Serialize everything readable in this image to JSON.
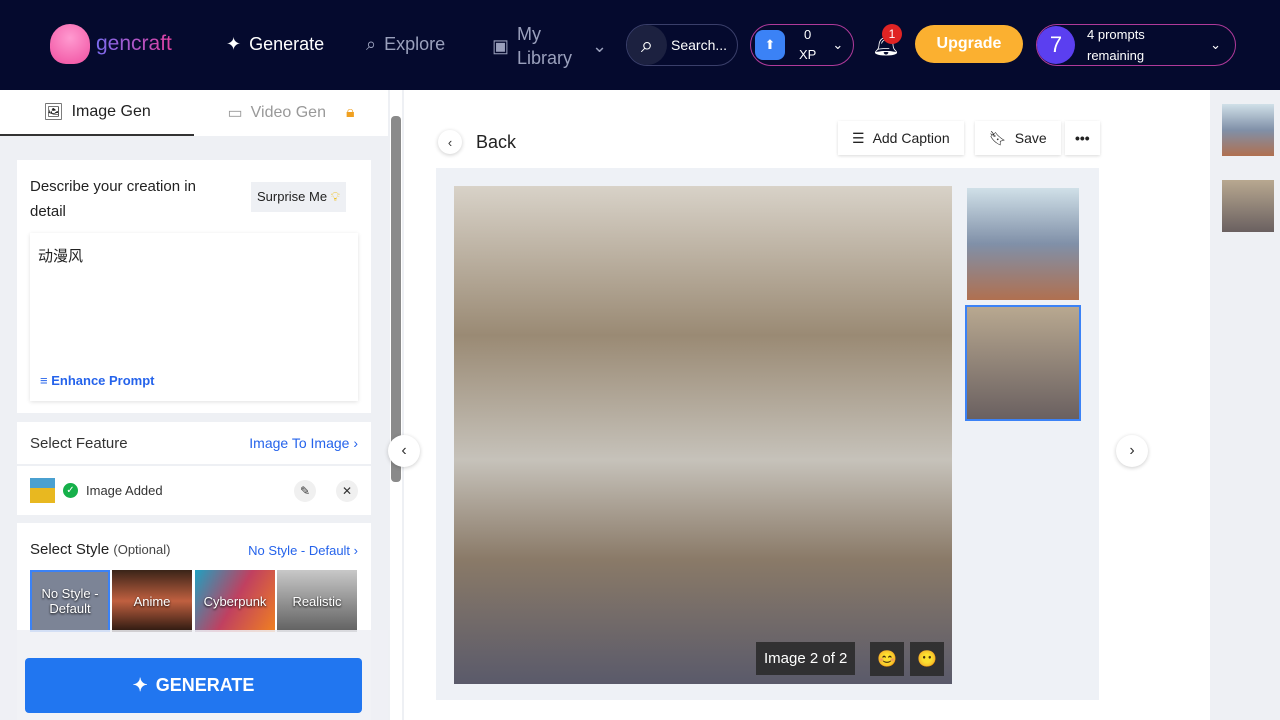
{
  "header": {
    "logo": "gencraft",
    "nav": [
      {
        "label": "Generate",
        "icon": "sparkles-icon"
      },
      {
        "label": "Explore",
        "icon": "search-icon"
      },
      {
        "label_line1": "My",
        "label_line2": "Library",
        "icon": "gallery-icon"
      }
    ],
    "search_label": "Search...",
    "xp_value": "0",
    "xp_unit": "XP",
    "notification_count": "1",
    "upgrade_label": "Upgrade",
    "prompts_count": "7",
    "prompts_line1": "4 prompts",
    "prompts_line2": "remaining"
  },
  "sidebar": {
    "tabs": [
      {
        "label": "Image Gen"
      },
      {
        "label": "Video Gen"
      }
    ],
    "prompt_label": "Describe your creation in detail",
    "surprise_label": "Surprise Me",
    "prompt_value": "动漫风",
    "enhance_label": "Enhance Prompt",
    "feature_label": "Select Feature",
    "feature_value": "Image To Image",
    "image_added": "Image Added",
    "style_label": "Select Style",
    "style_optional": "(Optional)",
    "style_value": "No Style - Default",
    "styles": [
      "No Style - Default",
      "Anime",
      "Cyberpunk",
      "Realistic"
    ],
    "generate_label": "GENERATE"
  },
  "main": {
    "back_label": "Back",
    "add_caption": "Add Caption",
    "save": "Save",
    "image_counter": "Image 2 of 2"
  },
  "colors": {
    "accent": "#2563eb",
    "header_bg": "#050a2e",
    "upgrade": "#fbb030"
  }
}
